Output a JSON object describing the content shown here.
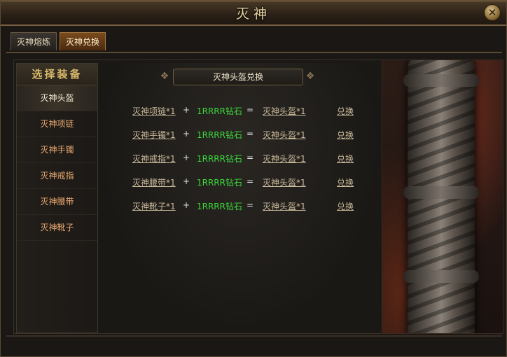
{
  "window": {
    "title": "灭神",
    "close_icon": "✕"
  },
  "tabs": [
    {
      "label": "灭神熔炼",
      "active": false
    },
    {
      "label": "灭神兑换",
      "active": true
    }
  ],
  "sidebar": {
    "heading": "选择装备",
    "items": [
      {
        "label": "灭神头盔",
        "selected": true
      },
      {
        "label": "灭神项链",
        "selected": false
      },
      {
        "label": "灭神手镯",
        "selected": false
      },
      {
        "label": "灭神戒指",
        "selected": false
      },
      {
        "label": "灭神腰带",
        "selected": false
      },
      {
        "label": "灭神靴子",
        "selected": false
      }
    ]
  },
  "exchange": {
    "header": "灭神头盔兑换",
    "rows": [
      {
        "ingredient": "灭神项链*1",
        "plus": "+",
        "cost": "1RRRR钻石",
        "equals": "=",
        "result": "灭神头盔*1",
        "action": "兑换"
      },
      {
        "ingredient": "灭神手镯*1",
        "plus": "+",
        "cost": "1RRRR钻石",
        "equals": "=",
        "result": "灭神头盔*1",
        "action": "兑换"
      },
      {
        "ingredient": "灭神戒指*1",
        "plus": "+",
        "cost": "1RRRR钻石",
        "equals": "=",
        "result": "灭神头盔*1",
        "action": "兑换"
      },
      {
        "ingredient": "灭神腰带*1",
        "plus": "+",
        "cost": "1RRRR钻石",
        "equals": "=",
        "result": "灭神头盔*1",
        "action": "兑换"
      },
      {
        "ingredient": "灭神靴子*1",
        "plus": "+",
        "cost": "1RRRR钻石",
        "equals": "=",
        "result": "灭神头盔*1",
        "action": "兑换"
      }
    ]
  },
  "colors": {
    "accent_gold": "#d8b86c",
    "cost_green": "#3cd83c",
    "side_item_orange": "#e8a870"
  }
}
